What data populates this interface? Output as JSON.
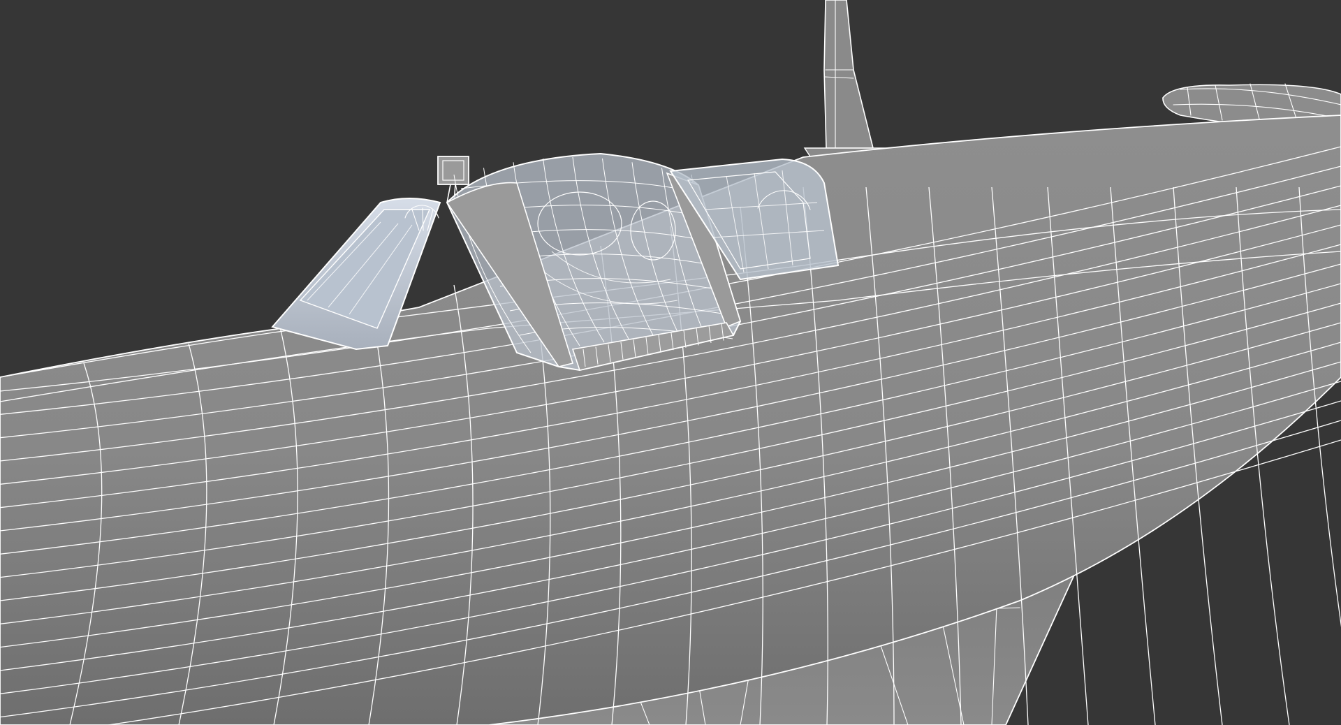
{
  "viewport": {
    "background_color": "#363636",
    "mesh_fill_color": "#8c8c8c",
    "mesh_dark_color": "#6f6f6f",
    "wire_color": "#ffffff",
    "glass_tint": "#c9d4e2"
  },
  "model": {
    "subject": "aircraft-fuselage-cockpit-wireframe"
  }
}
